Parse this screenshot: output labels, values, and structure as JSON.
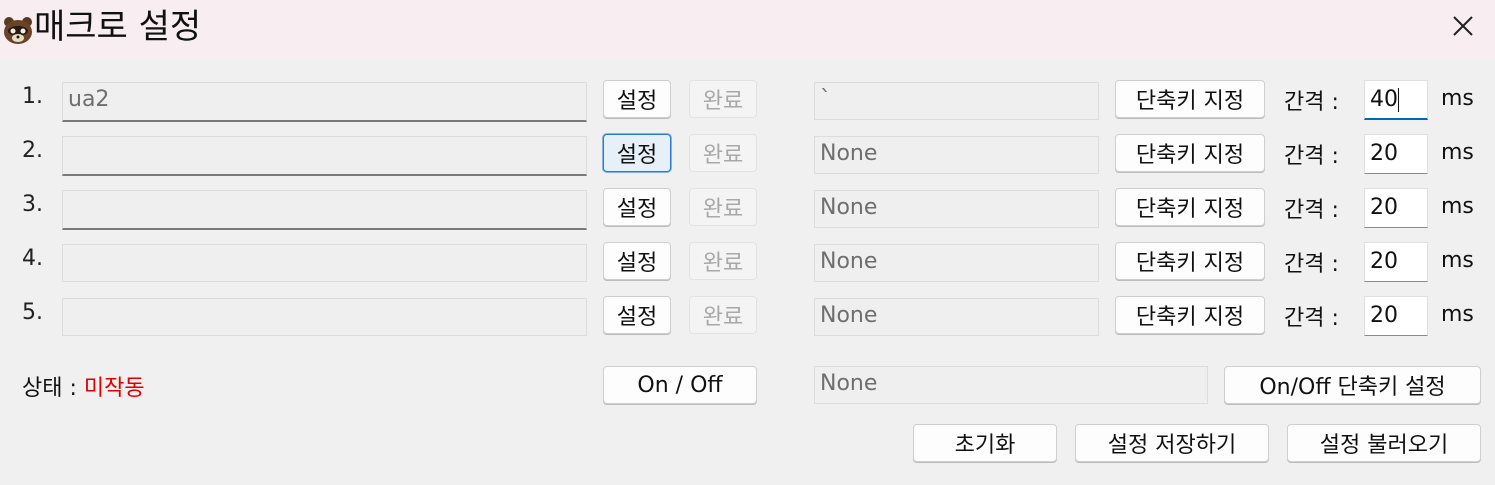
{
  "window": {
    "title": "매크로 설정"
  },
  "rows": [
    {
      "number": "1.",
      "macro_text": "ua2",
      "set_label": "설정",
      "done_label": "완료",
      "hotkey_value": "`",
      "hotkey_button": "단축키 지정",
      "interval_label": "간격 :",
      "interval_value": "40",
      "unit": "ms"
    },
    {
      "number": "2.",
      "macro_text": "",
      "set_label": "설정",
      "done_label": "완료",
      "hotkey_value": "None",
      "hotkey_button": "단축키 지정",
      "interval_label": "간격 :",
      "interval_value": "20",
      "unit": "ms"
    },
    {
      "number": "3.",
      "macro_text": "",
      "set_label": "설정",
      "done_label": "완료",
      "hotkey_value": "None",
      "hotkey_button": "단축키 지정",
      "interval_label": "간격 :",
      "interval_value": "20",
      "unit": "ms"
    },
    {
      "number": "4.",
      "macro_text": "",
      "set_label": "설정",
      "done_label": "완료",
      "hotkey_value": "None",
      "hotkey_button": "단축키 지정",
      "interval_label": "간격 :",
      "interval_value": "20",
      "unit": "ms"
    },
    {
      "number": "5.",
      "macro_text": "",
      "set_label": "설정",
      "done_label": "완료",
      "hotkey_value": "None",
      "hotkey_button": "단축키 지정",
      "interval_label": "간격 :",
      "interval_value": "20",
      "unit": "ms"
    }
  ],
  "status": {
    "label": "상태 : ",
    "value": "미작동"
  },
  "toggle": {
    "button_label": "On / Off",
    "hotkey_value": "None",
    "hotkey_button": "On/Off 단축키 설정"
  },
  "footer": {
    "reset": "초기화",
    "save": "설정 저장하기",
    "load": "설정 불러오기"
  },
  "colors": {
    "status_inactive": "#e00000",
    "focus_accent": "#0067c0"
  },
  "icons": {
    "app": "raccoon-icon",
    "close": "close-icon"
  }
}
